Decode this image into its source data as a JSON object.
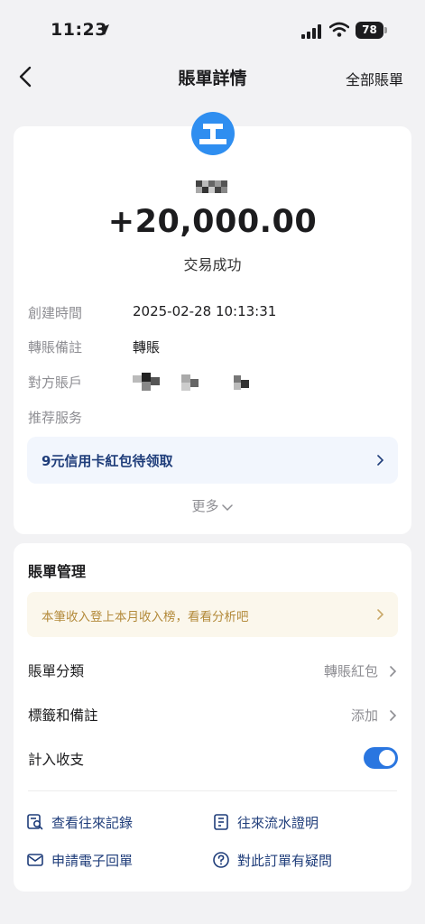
{
  "status_bar": {
    "time": "11:23",
    "battery": "78"
  },
  "nav": {
    "title": "賬單詳情",
    "right_link": "全部賬單"
  },
  "transaction": {
    "amount": "+20,000.00",
    "status": "交易成功",
    "details": [
      {
        "label": "創建時間",
        "value": "2025-02-28 10:13:31"
      },
      {
        "label": "轉賬備註",
        "value": "轉賬"
      },
      {
        "label": "對方賬戶",
        "value": ""
      },
      {
        "label": "推荐服务",
        "value": ""
      }
    ],
    "promo": "9元信用卡紅包待领取",
    "more": "更多"
  },
  "management": {
    "title": "賬單管理",
    "tip": "本筆收入登上本月收入榜，看看分析吧",
    "category": {
      "label": "賬單分類",
      "value": "轉賬紅包"
    },
    "tags": {
      "label": "標籤和備註",
      "value": "添加"
    },
    "count_in": {
      "label": "計入收支",
      "enabled": true
    },
    "links": [
      {
        "label": "查看往來記錄",
        "icon": "search-record-icon"
      },
      {
        "label": "往來流水證明",
        "icon": "statement-icon"
      },
      {
        "label": "申請電子回單",
        "icon": "mail-icon"
      },
      {
        "label": "對此訂單有疑問",
        "icon": "question-icon"
      }
    ]
  },
  "colors": {
    "accent": "#2a76e0",
    "link": "#1f3d7a",
    "tip_text": "#b38a3a",
    "tip_bg": "#fbf7ec",
    "promo_bg": "#f2f6fd"
  }
}
